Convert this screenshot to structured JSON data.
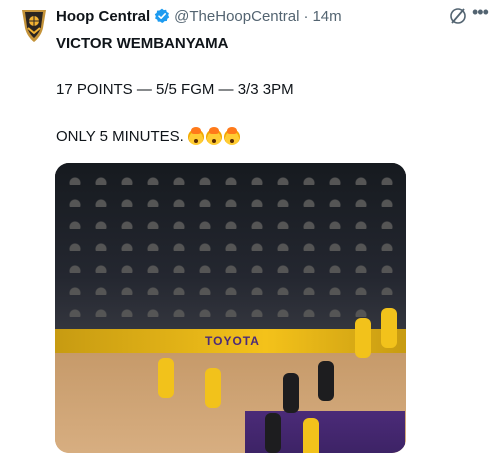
{
  "author": {
    "name": "Hoop Central",
    "handle": "@TheHoopCentral",
    "separator": "·",
    "time": "14m"
  },
  "tweet": {
    "line1": "VICTOR WEMBANYAMA",
    "line2": "17 POINTS — 5/5 FGM — 3/3 3PM",
    "line3": "ONLY 5 MINUTES."
  },
  "media": {
    "banner_text": "TOYOTA"
  },
  "icons": {
    "verified": "verified-badge-icon",
    "grok": "grok-icon",
    "more": "more-icon"
  },
  "colors": {
    "verified": "#1d9bf0",
    "secondary_text": "#536471"
  }
}
